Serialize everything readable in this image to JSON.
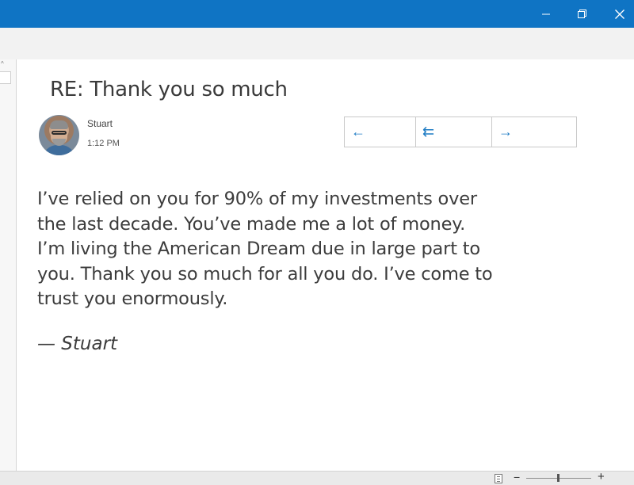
{
  "window": {
    "minimize_icon": "minimize-icon",
    "restore_icon": "restore-icon",
    "close_icon": "close-icon",
    "accent_color": "#0f74c4"
  },
  "message": {
    "subject": "RE: Thank you so much",
    "sender": "Stuart",
    "time": "1:12 PM",
    "body_lines": [
      "I’ve relied on you for 90% of my investments over",
      "the last decade. You’ve made me a lot of money.",
      "I’m living the American Dream due in large part to",
      "you. Thank you so much for all you do. I’ve come to",
      "trust you enormously."
    ],
    "signature": "— Stuart"
  },
  "actions": {
    "reply_icon": "←",
    "reply_all_icon": "⇇",
    "forward_icon": "→"
  },
  "statusbar": {
    "zoom_minus": "−",
    "zoom_plus": "+",
    "zoom_level_fraction": 0.5
  }
}
